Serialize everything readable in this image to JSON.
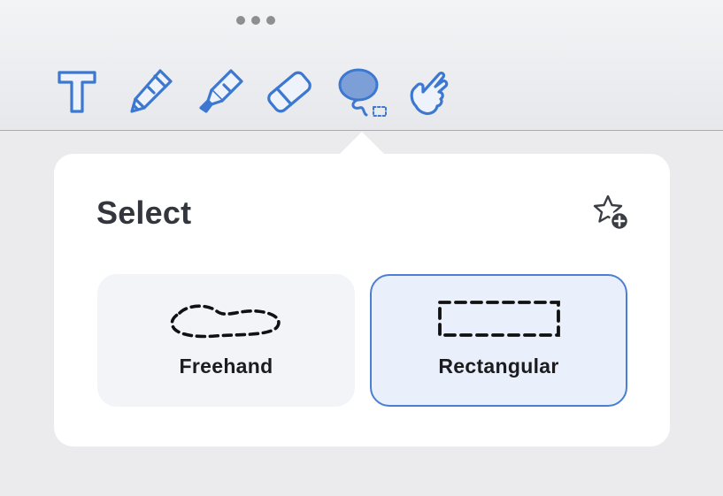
{
  "toolbar": {
    "tools": [
      {
        "id": "text",
        "icon": "text-icon",
        "active": false
      },
      {
        "id": "pencil",
        "icon": "pencil-icon",
        "active": false
      },
      {
        "id": "highlighter",
        "icon": "highlighter-icon",
        "active": false
      },
      {
        "id": "eraser",
        "icon": "eraser-icon",
        "active": false
      },
      {
        "id": "lasso",
        "icon": "lasso-select-icon",
        "active": true
      },
      {
        "id": "touch",
        "icon": "hand-touch-icon",
        "active": false
      }
    ],
    "accent_color": "#3c78d0"
  },
  "popover": {
    "title": "Select",
    "favorite_icon": "star-plus-icon",
    "options": [
      {
        "label": "Freehand",
        "icon": "freehand-lasso-icon",
        "selected": false
      },
      {
        "label": "Rectangular",
        "icon": "rectangle-select-icon",
        "selected": true
      }
    ]
  },
  "colors": {
    "selected_border": "#4a7fd1",
    "selected_bg": "#e9effb",
    "unselected_bg": "#f2f4f8"
  }
}
